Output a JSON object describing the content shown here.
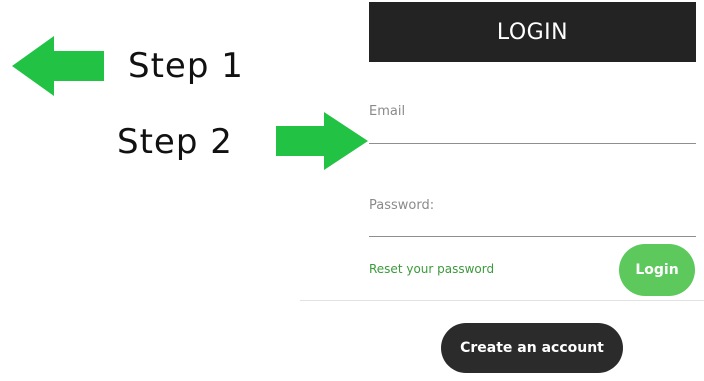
{
  "annotations": {
    "step1": {
      "label": "Step 1",
      "arrow_direction": "left",
      "arrow_color": "#22c244",
      "arrow_icon": "arrow-left-icon"
    },
    "step2": {
      "label": "Step 2",
      "arrow_direction": "right",
      "arrow_color": "#22c244",
      "arrow_icon": "arrow-right-icon"
    }
  },
  "login_form": {
    "title": "LOGIN",
    "email": {
      "label": "Email",
      "value": ""
    },
    "password": {
      "label": "Password:",
      "value": ""
    },
    "reset_link": "Reset your password",
    "login_button": "Login",
    "create_account_button": "Create an account"
  },
  "colors": {
    "header_bg": "#232323",
    "login_button_bg": "#5dc95d",
    "link": "#3c9a3c",
    "create_button_bg": "#2b2b2b"
  }
}
